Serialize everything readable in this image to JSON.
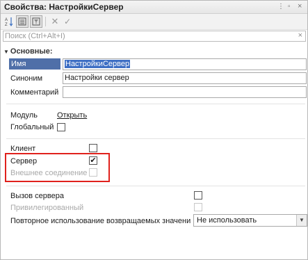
{
  "window": {
    "title": "Свойства: НастройкиСервер"
  },
  "toolbar": {
    "buttons": [
      "sort-az-icon",
      "categories-icon",
      "filter-icon",
      "clear-icon",
      "apply-icon"
    ]
  },
  "search": {
    "placeholder": "Поиск (Ctrl+Alt+I)",
    "value": ""
  },
  "section": {
    "title": "Основные:"
  },
  "fields": {
    "name": {
      "label": "Имя",
      "value": "НастройкиСервер"
    },
    "synonym": {
      "label": "Синоним",
      "value": "Настройки сервер"
    },
    "comment": {
      "label": "Комментарий",
      "value": ""
    }
  },
  "module": {
    "label": "Модуль",
    "link": "Открыть"
  },
  "global": {
    "label": "Глобальный",
    "checked": false
  },
  "client": {
    "label": "Клиент",
    "checked": false
  },
  "server": {
    "label": "Сервер",
    "checked": true,
    "check_glyph": "✔"
  },
  "external": {
    "label": "Внешнее соединение",
    "checked": false,
    "disabled": true
  },
  "server_call": {
    "label": "Вызов сервера",
    "checked": false
  },
  "privileged": {
    "label": "Привилегированный",
    "checked": false,
    "disabled": true
  },
  "reuse": {
    "label": "Повторное использование возвращаемых значени",
    "selected": "Не использовать"
  },
  "colors": {
    "highlight": "#e0211c",
    "selection": "#3e6fc4"
  }
}
